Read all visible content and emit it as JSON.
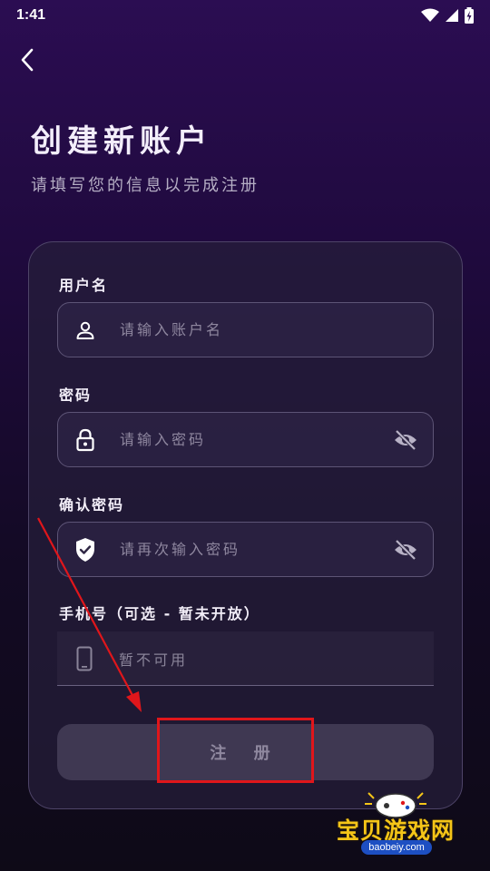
{
  "status_bar": {
    "time": "1:41",
    "icons": [
      "wifi-icon",
      "signal-icon",
      "battery-charging-icon"
    ]
  },
  "header": {
    "back_icon": "chevron-left-icon",
    "title": "创建新账户",
    "subtitle": "请填写您的信息以完成注册"
  },
  "form": {
    "username": {
      "label": "用户名",
      "placeholder": "请输入账户名",
      "value": "",
      "icon": "user-icon"
    },
    "password": {
      "label": "密码",
      "placeholder": "请输入密码",
      "value": "",
      "icon": "lock-icon",
      "toggle_icon": "eye-off-icon"
    },
    "confirm_password": {
      "label": "确认密码",
      "placeholder": "请再次输入密码",
      "value": "",
      "icon": "shield-check-icon",
      "toggle_icon": "eye-off-icon"
    },
    "phone": {
      "label": "手机号（可选 - 暂未开放）",
      "placeholder": "暂不可用",
      "icon": "phone-icon",
      "disabled": true
    },
    "submit_label": "注 册"
  },
  "watermark": {
    "text": "宝贝游戏网",
    "url": "baobeiy.com"
  },
  "colors": {
    "background_top": "#2b0d52",
    "background_bottom": "#0e0a17",
    "card_border": "#4e4468",
    "annotation_red": "#e0161b",
    "watermark_yellow": "#f5c518"
  }
}
